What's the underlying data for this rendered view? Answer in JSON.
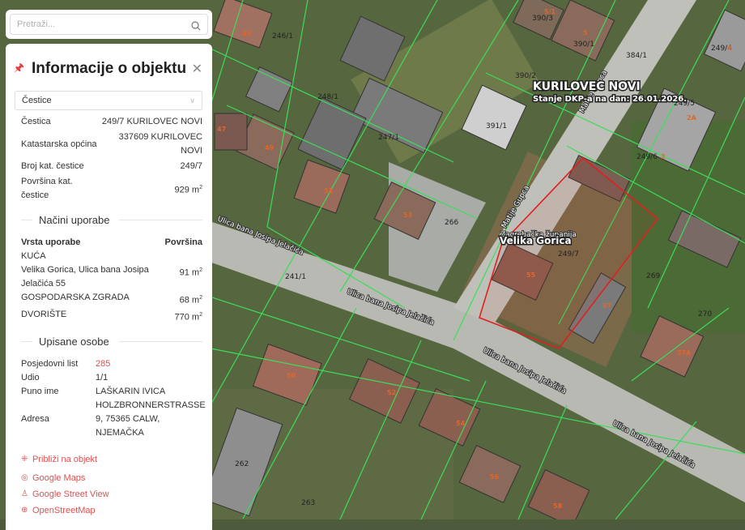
{
  "search": {
    "placeholder": "Pretraži..."
  },
  "panel": {
    "title": "Informacije o objektu",
    "layer_select": "Čestice",
    "fields": [
      {
        "label": "Čestica",
        "value": "249/7 KURILOVEC NOVI"
      },
      {
        "label": "Katastarska općina",
        "value": "337609 KURILOVEC NOVI"
      },
      {
        "label": "Broj kat. čestice",
        "value": "249/7"
      },
      {
        "label": "Površina kat. čestice",
        "value": "929 m",
        "sup": "2"
      }
    ],
    "usage_section": "Načini uporabe",
    "usage_headers": {
      "type": "Vrsta uporabe",
      "area": "Površina"
    },
    "usage_rows": [
      {
        "type": "KUĆA",
        "area": ""
      },
      {
        "type": "Velika Gorica, Ulica bana Josipa Jelačića 55",
        "area": "91 m",
        "sup": "2"
      },
      {
        "type": "GOSPODARSKA ZGRADA",
        "area": "68 m",
        "sup": "2"
      },
      {
        "type": "DVORIŠTE",
        "area": "770 m",
        "sup": "2"
      }
    ],
    "persons_section": "Upisane osobe",
    "persons": [
      {
        "label": "Posjedovni list",
        "value": "285"
      },
      {
        "label": "Udio",
        "value": "1/1"
      },
      {
        "label": "Puno ime",
        "value": "LAŠKARIN IVICA"
      },
      {
        "label": "Adresa",
        "value": "HOLZBRONNERSTRASSE 9, 75365 CALW, NJEMAČKA"
      }
    ],
    "links": [
      "Približi na objekt",
      "Google Maps",
      "Google Street View",
      "OpenStreetMap"
    ]
  },
  "map": {
    "area_name": "KURILOVEC NOVI",
    "dkp_state": "Stanje DKP-a na dan: 26.01.2026.",
    "city": "Velika Gorica",
    "county": "Zagrebačka županija",
    "streets": [
      "Ulica bana Josipa Jelačića",
      "Ulica bana Josipa Jelačića",
      "Ulica bana Josipa Jelačića",
      "Ulica bana Josipa Jelačića",
      "Matije Gupca",
      "Matije Gupca"
    ],
    "parcels": [
      "246/1",
      "248/1",
      "247/1",
      "266",
      "241/1",
      "249/7",
      "269",
      "270",
      "391/1",
      "384/1",
      "390/1",
      "390/3",
      "390/2",
      "249/5",
      "249/6",
      "249/4",
      "262",
      "263"
    ],
    "house_numbers": [
      "45",
      "47",
      "49",
      "51",
      "53",
      "55",
      "57",
      "57A",
      "50",
      "52",
      "54",
      "56",
      "58",
      "5",
      "5/1",
      "2A",
      "2",
      "4"
    ],
    "colors": {
      "accent": "#e05050",
      "parcel_line": "#3ddc5a",
      "selected": "#e02020"
    }
  }
}
